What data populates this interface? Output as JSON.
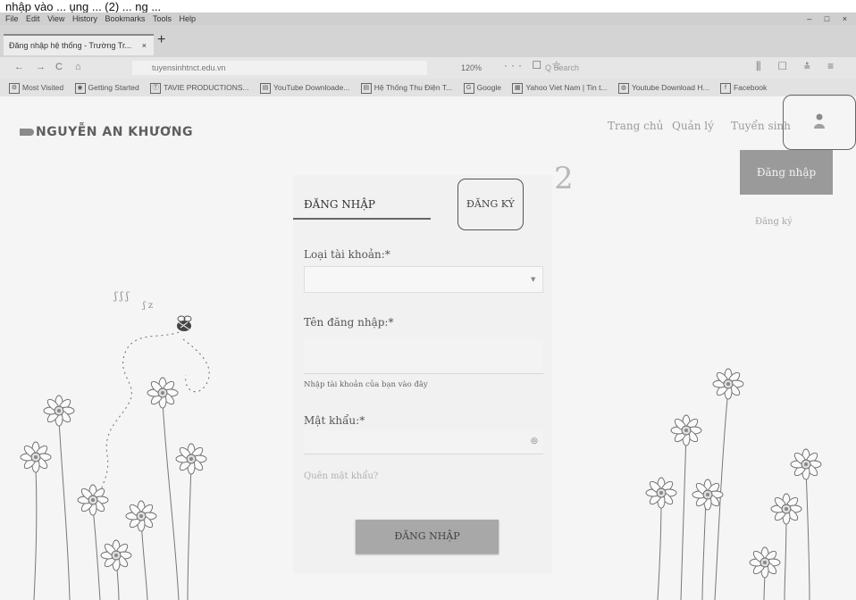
{
  "caption": "nhập vào ... ụng ... (2) ... ng ...",
  "menu": {
    "items": [
      "File",
      "Edit",
      "View",
      "History",
      "Bookmarks",
      "Tools",
      "Help"
    ],
    "window_controls": [
      "–",
      "□",
      "×"
    ]
  },
  "tab": {
    "title": "Đăng nhập hệ thống - Trường Tr...",
    "close": "×",
    "new_tab": "+"
  },
  "nav": {
    "back": "←",
    "forward": "→",
    "reload": "C",
    "home": "⌂",
    "url": "tuyensinhtnct.edu.vn",
    "zoom": "120%",
    "url_icons": "··· ☐ ☆",
    "search_placeholder": "Q Search",
    "right_icons": "⫼ ☐ ≗ ≡"
  },
  "bookmarks": [
    {
      "icon": "⚙",
      "label": "Most Visited"
    },
    {
      "icon": "◉",
      "label": "Getting Started"
    },
    {
      "icon": "Ⓣ",
      "label": "TAVIE PRODUCTIONS..."
    },
    {
      "icon": "▤",
      "label": "YouTube Downloade..."
    },
    {
      "icon": "▤",
      "label": "Hệ Thống Thu Điện T..."
    },
    {
      "icon": "G",
      "label": "Google"
    },
    {
      "icon": "▦",
      "label": "Yahoo Viet Nam | Tin t..."
    },
    {
      "icon": "◍",
      "label": "Youtube Download H..."
    },
    {
      "icon": "f",
      "label": "Facebook"
    }
  ],
  "site": {
    "logo": "NGUYỄN AN KHƯƠNG",
    "nav": [
      "Trang chủ",
      "Quản lý",
      "Tuyển sinh"
    ],
    "dropdown": {
      "login": "Đăng nhập",
      "register": "Đăng ký"
    },
    "annotation_number": "2"
  },
  "form": {
    "tab_login": "ĐĂNG NHẬP",
    "tab_register": "ĐĂNG KÝ",
    "account_type_label": "Loại tài khoản:*",
    "account_type_value": "",
    "caret": "▼",
    "username_label": "Tên đăng nhập:*",
    "username_value": "",
    "username_hint": "Nhập tài khoản của bạn vào đây",
    "password_label": "Mật khẩu:*",
    "password_value": "",
    "eye": "◎",
    "forgot": "Quên mật khẩu?",
    "submit": "ĐĂNG NHẬP"
  },
  "colors": {
    "primary_button": "#a8a8a8",
    "dropdown_button": "#9a9a9a",
    "page_bg": "#f5f5f5"
  }
}
